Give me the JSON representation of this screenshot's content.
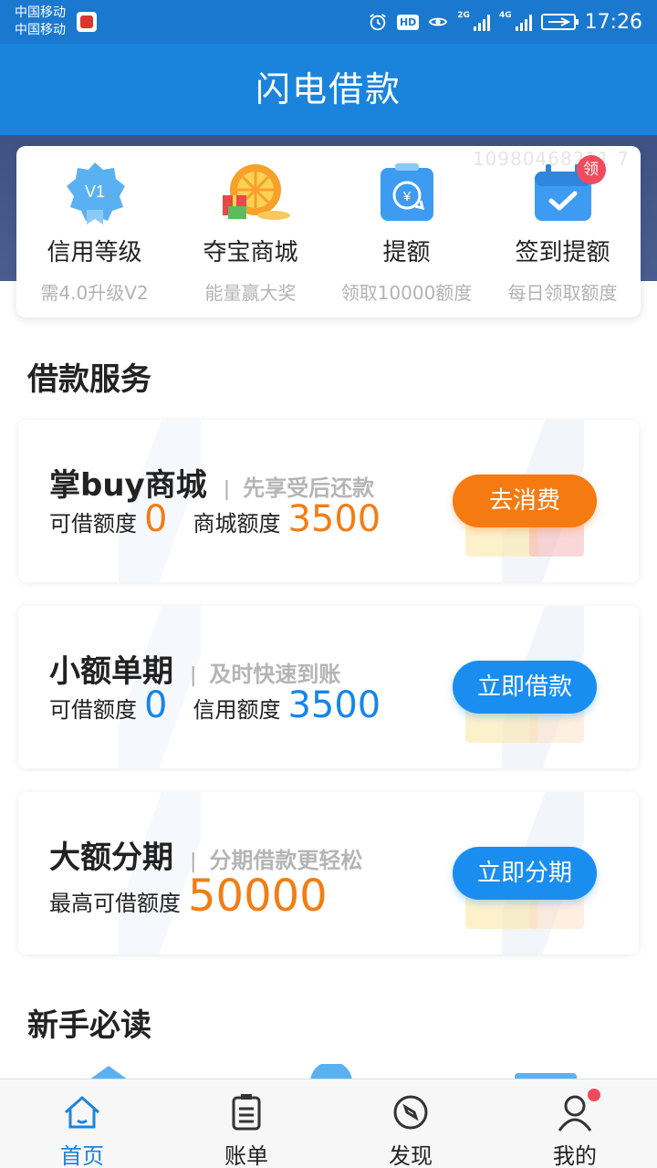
{
  "status_bar": {
    "carrier_line1": "中国移动",
    "carrier_line2": "中国移动",
    "hd": "HD",
    "net_2g": "2G",
    "net_4g": "4G",
    "time": "17:26"
  },
  "header": {
    "title": "闪电借款"
  },
  "quick_card": {
    "watermark": "10980468211 7",
    "items": [
      {
        "title": "信用等级",
        "subtitle": "需4.0升级V2",
        "icon": "v1-badge-icon",
        "badge_text": "V1"
      },
      {
        "title": "夺宝商城",
        "subtitle": "能量赢大奖",
        "icon": "treasure-wheel-icon"
      },
      {
        "title": "提额",
        "subtitle": "领取10000额度",
        "icon": "raise-limit-icon",
        "badge_text": "¥"
      },
      {
        "title": "签到提额",
        "subtitle": "每日领取额度",
        "icon": "calendar-check-icon",
        "badge_text": "领"
      }
    ]
  },
  "loan_section": {
    "title": "借款服务"
  },
  "services": [
    {
      "name": "掌buy商城",
      "slogan": "先享受后还款",
      "label1": "可借额度",
      "value1": "0",
      "label2": "商城额度",
      "value2": "3500",
      "button": "去消费",
      "accent": "#f27d15"
    },
    {
      "name": "小额单期",
      "slogan": "及时快速到账",
      "label1": "可借额度",
      "value1": "0",
      "label2": "信用额度",
      "value2": "3500",
      "button": "立即借款",
      "accent": "#1585ea"
    },
    {
      "name": "大额分期",
      "slogan": "分期借款更轻松",
      "label1": "最高可借额度",
      "value1": "50000",
      "button": "立即分期",
      "accent": "#f27d15"
    }
  ],
  "newbie_section": {
    "title": "新手必读"
  },
  "bottom_nav": {
    "items": [
      {
        "label": "首页",
        "icon": "home-icon",
        "active": true
      },
      {
        "label": "账单",
        "icon": "bill-icon"
      },
      {
        "label": "发现",
        "icon": "compass-icon"
      },
      {
        "label": "我的",
        "icon": "user-icon",
        "dot": true
      }
    ]
  },
  "colors": {
    "primary": "#1a84dc",
    "orange": "#f27d15",
    "blue": "#1585ea",
    "badge_red": "#f04a5c"
  }
}
